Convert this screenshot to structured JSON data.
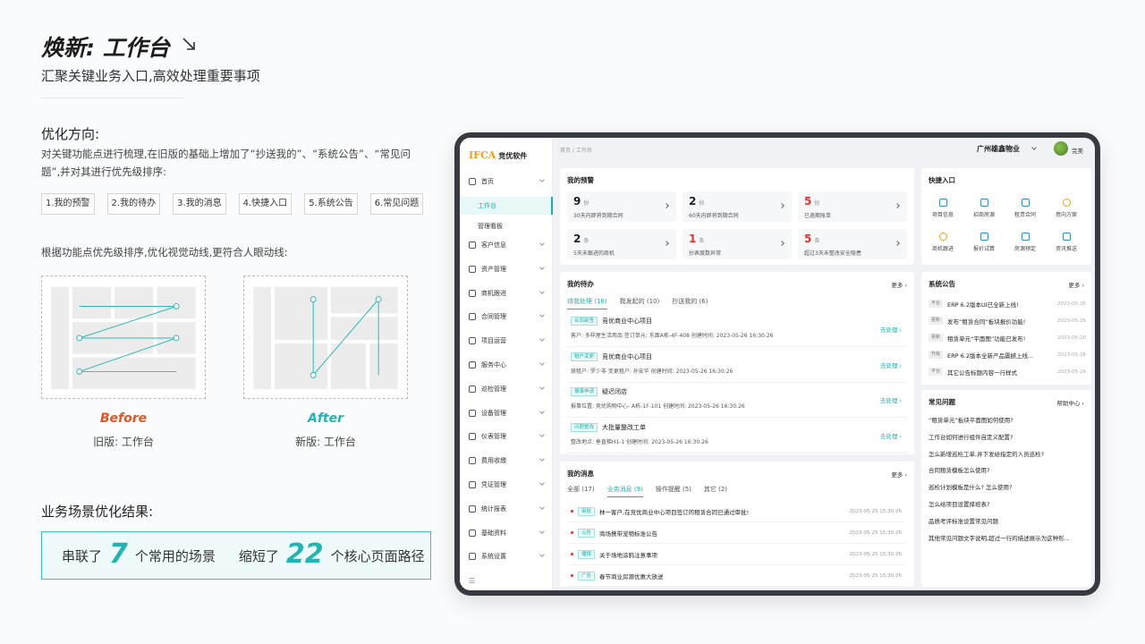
{
  "header": {
    "title": "焕新: 工作台",
    "subtitle": "汇聚关键业务入口,高效处理重要事项"
  },
  "optimize": {
    "title": "优化方向:",
    "desc": "对关键功能点进行梳理,在旧版的基础上增加了“抄送我的”、“系统公告”、“常见问题”,并对其进行优先级排序:",
    "items": [
      "1.我的预警",
      "2.我的待办",
      "3.我的消息",
      "4.快捷入口",
      "5.系统公告",
      "6.常见问题"
    ],
    "flow_desc": "根据功能点优先级排序,优化视觉动线,更符合人眼动线:"
  },
  "compare": {
    "before_label": "Before",
    "before_sub": "旧版: 工作台",
    "after_label": "After",
    "after_sub": "新版: 工作台"
  },
  "result": {
    "title": "业务场景优化结果:",
    "part1": "串联了",
    "num1": "7",
    "part2": "个常用的场景",
    "part3": "缩短了",
    "num2": "22",
    "part4": "个核心页面路径"
  },
  "app": {
    "logo_mark": "IFCA",
    "logo_text": "竞优软件",
    "breadcrumb": "首页 / 工作台",
    "company": "广州雄鑫物业",
    "user": "完美",
    "sidebar": {
      "home": "首页",
      "home_subs": [
        "工作台",
        "管理看板"
      ],
      "items": [
        "客户信息",
        "资产管理",
        "商机跟进",
        "合同管理",
        "项目运营",
        "服务中心",
        "巡检管理",
        "设备管理",
        "仪表管理",
        "费用收缴",
        "凭证管理",
        "统计报表",
        "基础资料",
        "系统设置"
      ]
    },
    "warning": {
      "title": "我的预警",
      "unit_a": "份",
      "unit_b": "条",
      "boxes": [
        {
          "num": "9",
          "unit": "份",
          "label": "30天内即将到期合同"
        },
        {
          "num": "2",
          "unit": "份",
          "label": "60天内即将到期合同"
        },
        {
          "num": "5",
          "unit": "份",
          "label": "已逾期账单"
        },
        {
          "num": "2",
          "unit": "条",
          "label": "5天未跟进的商机"
        },
        {
          "num": "1",
          "unit": "条",
          "label": "抄表度数异常"
        },
        {
          "num": "5",
          "unit": "条",
          "label": "超过3天未整改安全隐患"
        }
      ]
    },
    "todo": {
      "title": "我的待办",
      "more": "更多 ›",
      "tabs": [
        "待我处理 (16)",
        "我发起的 (10)",
        "抄送我的 (6)"
      ],
      "action": "去处理 ›",
      "rows": [
        {
          "tag": "合同新签",
          "title": "竞优商业中心项目",
          "detail": "客户: 多样屋生活用品     签订单元: 东面A栋-4F-408     创建时间: 2023-05-26 16:30:26"
        },
        {
          "tag": "租户变更",
          "title": "竞优商业中心项目",
          "detail": "原租户: 罗少非     变更租户: 孙安华     创建时间: 2023-05-26 16:30:26"
        },
        {
          "tag": "报事申请",
          "title": "疑迟闭店",
          "detail": "报事位置: 竞优购物中心- A栋-1F-101     创建时间: 2023-05-26 16:30:26"
        },
        {
          "tag": "问题整改",
          "title": "大批量整改工单",
          "detail": "整改地点: 垂直梯H1-1     创建时间: 2023-05-26 16:30:26"
        }
      ]
    },
    "messages": {
      "title": "我的消息",
      "more": "更多 ›",
      "tabs": [
        "全部 (17)",
        "业务消息 (9)",
        "操作提醒 (5)",
        "其它 (2)"
      ],
      "rows": [
        {
          "tag": "审批",
          "text": "林一客户,在竞优商业中心项目签订的租赁合同已通过审批!",
          "time": "2023-05-25 15:30:26"
        },
        {
          "tag": "公告",
          "text": "商场携带宠物标准公告",
          "time": "2023-05-25 15:30:26"
        },
        {
          "tag": "播报",
          "text": "关于场地涂鸦注意事项",
          "time": "2023-05-25 15:30:26"
        },
        {
          "tag": "广告",
          "text": "春节商业房源优惠大放送",
          "time": "2023-05-25 15:30:26"
        }
      ]
    },
    "quick": {
      "title": "快捷入口",
      "items": [
        "项目信息",
        "招商房源",
        "租赁合同",
        "意向方案",
        "商机跟进",
        "报价试算",
        "房源预定",
        "资讯推送"
      ]
    },
    "notice": {
      "title": "系统公告",
      "more": "更多 ›",
      "rows": [
        {
          "tag": "平台",
          "text": "ERP 6.2版本UI已全新上线!",
          "time": "2023-05-26"
        },
        {
          "tag": "更新",
          "text": "发布“租赁合同”板块报价功能!",
          "time": "2023-05-26"
        },
        {
          "tag": "更新",
          "text": "租赁单元“平面图”功能已发布!",
          "time": "2023-05-26"
        },
        {
          "tag": "升级",
          "text": "ERP 6.2版本全新产品震撼上线...",
          "time": "2023-05-26"
        },
        {
          "tag": "平台",
          "text": "其它公告标题内容一行样式",
          "time": "2023-05-26"
        }
      ]
    },
    "faq": {
      "title": "常见问题",
      "more": "帮助中心 ›",
      "items": [
        "“租赁单元”板块平面图如何使用?",
        "工作台如何进行组件自定义配置?",
        "怎么新增巡检工单,并下发给指定的人员巡检?",
        "合同租赁模板怎么使用?",
        "巡检计划模板是什么? 怎么使用?",
        "怎么给项目设置择班表?",
        "品质考评标准设置常见问题",
        "其他常见问题文字说明,超过一行的描述展示为这种形..."
      ]
    }
  }
}
